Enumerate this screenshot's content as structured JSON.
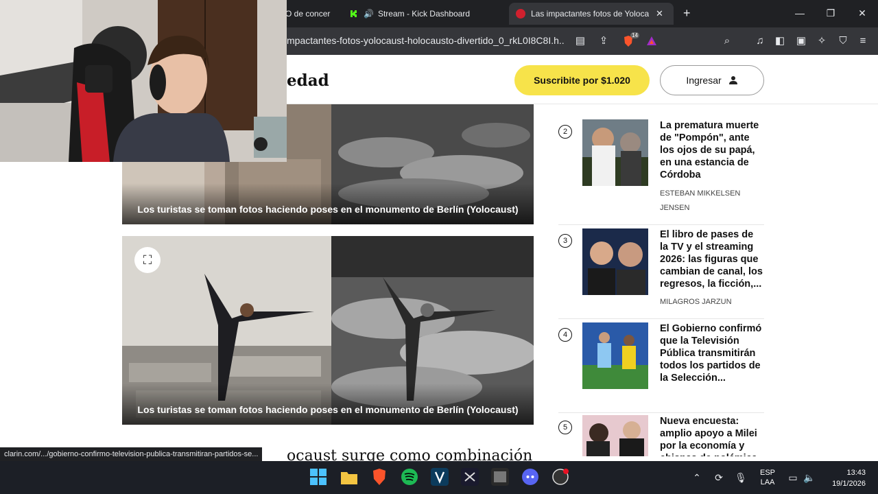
{
  "browser": {
    "tabs": [
      {
        "label": "O de concer"
      },
      {
        "label": "Stream - Kick Dashboard"
      },
      {
        "label": "Las impactantes fotos de Yolocau"
      }
    ],
    "url": "mpactantes-fotos-yolocaust-holocausto-divertido_0_rkL0I8C8I.h...",
    "new_tab": "+",
    "shield_badge": "14"
  },
  "header": {
    "brand_fragment": "edad",
    "subscribe_label": "Suscribite por $1.020",
    "login_label": "Ingresar"
  },
  "article": {
    "figures": [
      {
        "caption": "Los turistas se toman fotos haciendo poses en el monumento de Berlín (Yolocaust)"
      },
      {
        "caption": "Los turistas se toman fotos haciendo poses en el monumento de Berlín (Yolocaust)"
      }
    ],
    "body_fragment": "ocaust surge como combinación de"
  },
  "sidebar": {
    "items": [
      {
        "rank": "2",
        "headline": "La prematura muerte de \"Pompón\", ante los ojos de su papá, en una estancia de Córdoba",
        "author": "ESTEBAN MIKKELSEN JENSEN"
      },
      {
        "rank": "3",
        "headline": "El libro de pases de la TV y el streaming 2026: las figuras que cambian de canal, los regresos, la ficción,...",
        "author": "MILAGROS JARZUN"
      },
      {
        "rank": "4",
        "headline": "El Gobierno confirmó que la Televisión Pública transmitirán todos los partidos de la Selección...",
        "author": ""
      },
      {
        "rank": "5",
        "headline": "Nueva encuesta: amplio apoyo a Milei por la economía y chispas de polémica",
        "author": ""
      }
    ]
  },
  "status_bar": {
    "link_preview": "clarin.com/.../gobierno-confirmo-television-publica-transmitiran-partidos-se..."
  },
  "taskbar": {
    "language": "ESP",
    "layout": "LAA",
    "time": "13:43",
    "date": "19/1/2026"
  },
  "colors": {
    "subscribe_yellow": "#f7e34a",
    "kick_green": "#53fc18",
    "brave_orange": "#fb542b",
    "spotify_green": "#1db954"
  }
}
